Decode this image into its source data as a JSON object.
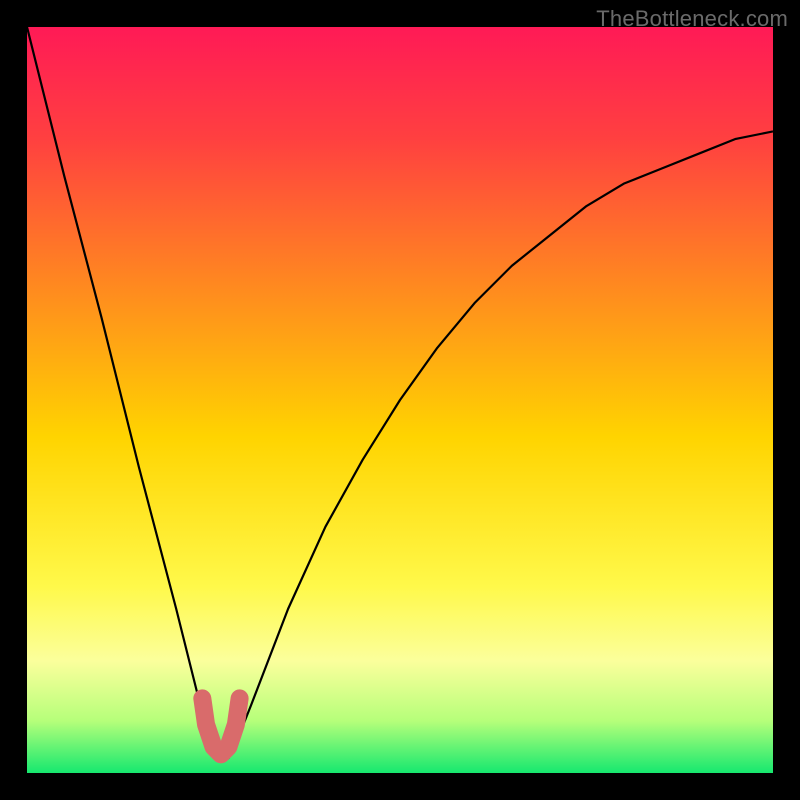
{
  "watermark": "TheBottleneck.com",
  "chart_data": {
    "type": "line",
    "title": "",
    "xlabel": "",
    "ylabel": "",
    "xlim": [
      0,
      100
    ],
    "ylim": [
      0,
      100
    ],
    "legend": false,
    "grid": false,
    "series": [
      {
        "name": "curve",
        "x": [
          0,
          5,
          10,
          15,
          20,
          23,
          25,
          26,
          27,
          28,
          30,
          35,
          40,
          45,
          50,
          55,
          60,
          65,
          70,
          75,
          80,
          85,
          90,
          95,
          100
        ],
        "y": [
          100,
          80,
          61,
          41,
          22,
          10,
          4,
          2,
          2,
          4,
          9,
          22,
          33,
          42,
          50,
          57,
          63,
          68,
          72,
          76,
          79,
          81,
          83,
          85,
          86
        ]
      },
      {
        "name": "optimal-band",
        "x": [
          23.5,
          24,
          25,
          26,
          27,
          28,
          28.5
        ],
        "y": [
          10,
          6.5,
          3.5,
          2.5,
          3.5,
          6.5,
          10
        ]
      }
    ],
    "gradient_stops": [
      {
        "pct": 0,
        "color": "#ff1a56"
      },
      {
        "pct": 15,
        "color": "#ff4040"
      },
      {
        "pct": 35,
        "color": "#ff8a1f"
      },
      {
        "pct": 55,
        "color": "#ffd400"
      },
      {
        "pct": 75,
        "color": "#fff94a"
      },
      {
        "pct": 85,
        "color": "#fbff9c"
      },
      {
        "pct": 93,
        "color": "#b6ff7a"
      },
      {
        "pct": 100,
        "color": "#16e86f"
      }
    ]
  }
}
